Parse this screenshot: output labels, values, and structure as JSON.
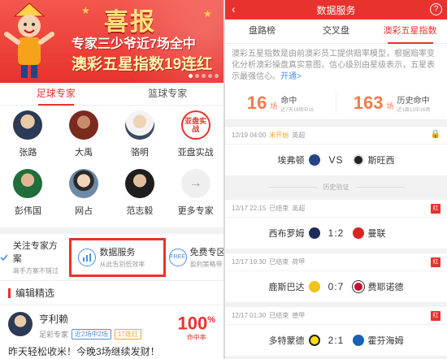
{
  "left": {
    "banner": {
      "big_word": "喜报",
      "line1": "专家三少爷近7场全中",
      "line2": "澳彩五星指数19连红"
    },
    "tabs": [
      {
        "label": "足球专家"
      },
      {
        "label": "篮球专家"
      }
    ],
    "experts": [
      {
        "name": "张路"
      },
      {
        "name": "大禹"
      },
      {
        "name": "骆明"
      },
      {
        "name": "亚盘实战",
        "avatar_text": "亚盘实战"
      },
      {
        "name": "彭伟国"
      },
      {
        "name": "网占"
      },
      {
        "name": "范志毅"
      },
      {
        "name": "更多专家",
        "avatar_icon": "→"
      }
    ],
    "services": [
      {
        "title": "关注专家方案",
        "sub": "高手方案不错过"
      },
      {
        "title": "数据服务",
        "sub": "从此告别低效率"
      },
      {
        "title": "免费专区",
        "sub": "盈利策略带",
        "icon_text": "FREE"
      }
    ],
    "section_title": "编辑精选",
    "post": {
      "name": "亨利赖",
      "role": "足彩专家",
      "tag1": "近2场中2场",
      "tag2": "17连红",
      "rate": "100",
      "rate_unit": "%",
      "rate_label": "命中率",
      "text": "昨天轻松收米！今晚3场继续发财！"
    }
  },
  "right": {
    "header_title": "数据服务",
    "back_glyph": "‹",
    "help_glyph": "?",
    "tabs": [
      {
        "label": "盘路榜"
      },
      {
        "label": "交叉盘"
      },
      {
        "label": "澳彩五星指数"
      }
    ],
    "intro": "澳彩五星指数是由前澳彩员工提供赔率模型，根据赔率变化分析澳彩操盘真实意图，信心级别由星级表示，五星表示最强信心。",
    "intro_more": "开通>",
    "stats": [
      {
        "value": "16",
        "unit": "场",
        "label": "命中",
        "sub": "近7天16场中16"
      },
      {
        "value": "163",
        "unit": "场",
        "label": "历史命中",
        "sub": "近1周12中16场"
      }
    ],
    "upcoming": {
      "time": "12/19 04:00",
      "status": "未开始",
      "league": "英超",
      "home": "埃弗顿",
      "vs": "VS",
      "away": "斯旺西"
    },
    "history_label": "历史验证",
    "results": [
      {
        "time": "12/17 22:15",
        "status": "已结束",
        "league": "英超",
        "home": "西布罗姆",
        "score": "1:2",
        "away": "曼联",
        "badge": "红",
        "home_color": "#1d2b5a",
        "away_color": "#d7261e"
      },
      {
        "time": "12/17 19:30",
        "status": "已结束",
        "league": "荷甲",
        "home": "鹿斯巴达",
        "score": "0:7",
        "away": "费耶诺德",
        "badge": "红",
        "home_color": "#f0c419",
        "away_color": "#c8102e"
      },
      {
        "time": "12/17 01:30",
        "status": "已结束",
        "league": "德甲",
        "home": "多特蒙德",
        "score": "2:1",
        "away": "霍芬海姆",
        "badge": "红",
        "home_color": "#fde100",
        "away_color": "#1961b5"
      }
    ],
    "upcoming_colors": {
      "home": "#274488",
      "away": "#222222"
    }
  },
  "colors": {
    "accent": "#e8322d",
    "blue": "#4a90e2",
    "orange": "#f47a4f"
  }
}
